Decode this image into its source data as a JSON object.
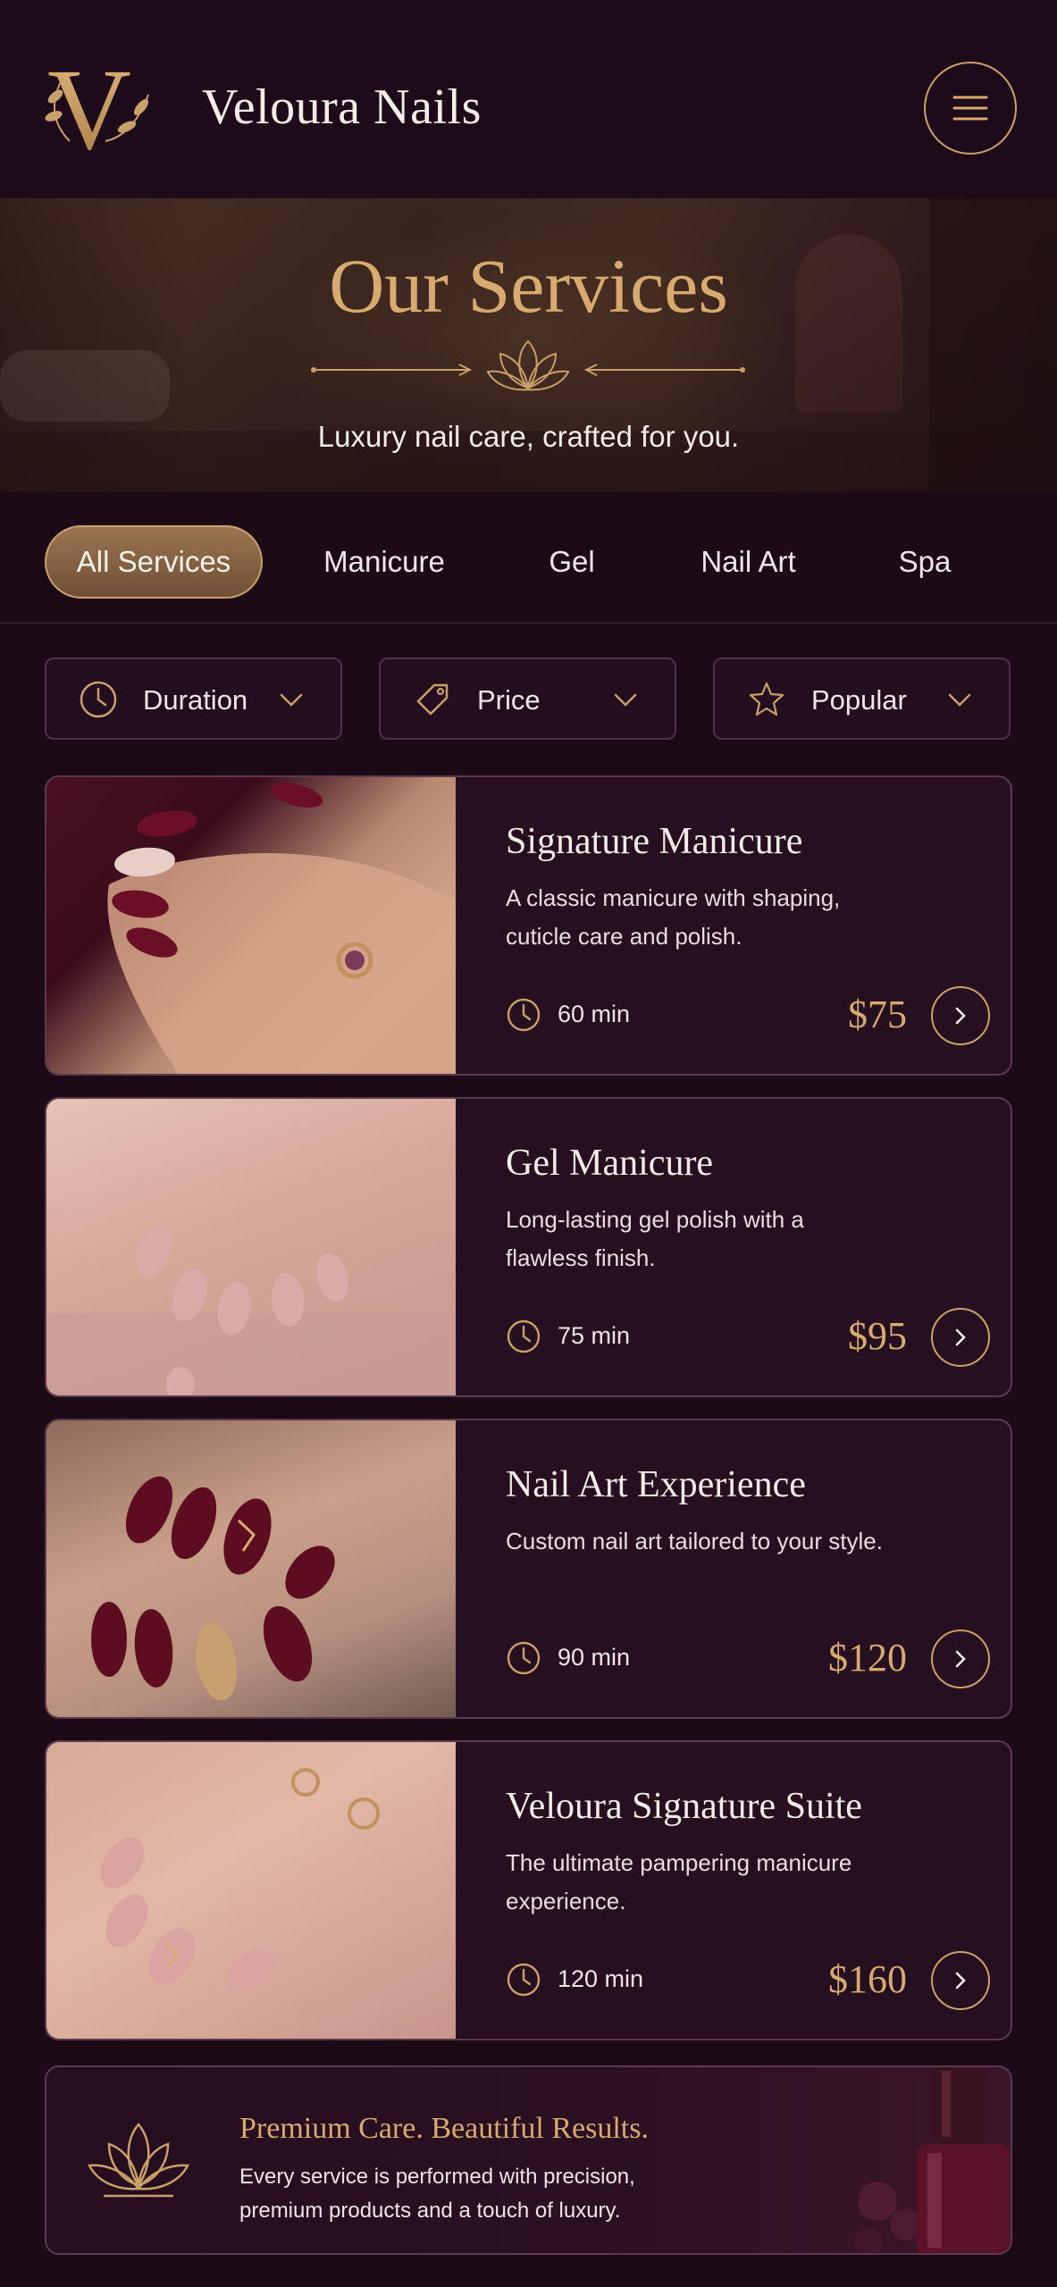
{
  "header": {
    "logo_letter": "V",
    "brand_name": "Veloura Nails",
    "menu_icon": "hamburger-menu-icon"
  },
  "hero": {
    "title": "Our Services",
    "subtitle": "Luxury nail care, crafted for you."
  },
  "tabs": [
    {
      "label": "All Services",
      "active": true
    },
    {
      "label": "Manicure",
      "active": false
    },
    {
      "label": "Gel",
      "active": false
    },
    {
      "label": "Nail Art",
      "active": false
    },
    {
      "label": "Spa",
      "active": false
    }
  ],
  "filters": [
    {
      "label": "Duration",
      "icon": "clock-icon"
    },
    {
      "label": "Price",
      "icon": "tag-icon"
    },
    {
      "label": "Popular",
      "icon": "star-icon"
    }
  ],
  "services": [
    {
      "title": "Signature Manicure",
      "description": "A classic manicure with shaping, cuticle care and polish.",
      "duration": "60 min",
      "price": "$75",
      "nail_color": "#6b0f26"
    },
    {
      "title": "Gel Manicure",
      "description": "Long-lasting gel polish with a flawless finish.",
      "duration": "75 min",
      "price": "$95",
      "nail_color": "#d9aaa7"
    },
    {
      "title": "Nail Art Experience",
      "description": "Custom nail art tailored to your style.",
      "duration": "90 min",
      "price": "$120",
      "nail_color": "#5e0d20"
    },
    {
      "title": "Veloura Signature Suite",
      "description": "The ultimate pampering manicure experience.",
      "duration": "120 min",
      "price": "$160",
      "nail_color": "#d9a3a0"
    }
  ],
  "banner": {
    "title": "Premium Care. Beautiful Results.",
    "text": "Every service is performed with precision, premium products and a touch of luxury."
  },
  "colors": {
    "background": "#1c0b17",
    "gold": "#d7aa70",
    "card": "#260f1f"
  }
}
